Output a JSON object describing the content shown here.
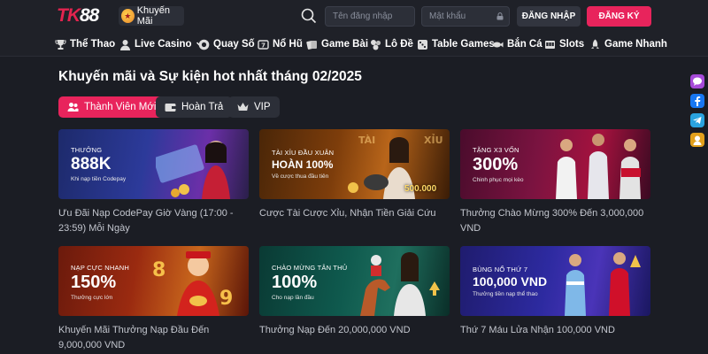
{
  "header": {
    "logo_tk": "TK",
    "logo_88": "88",
    "promo_label": "Khuyến Mãi",
    "username_placeholder": "Tên đăng nhập",
    "password_placeholder": "Mật khẩu",
    "login_label": "ĐĂNG NHẬP",
    "register_label": "ĐĂNG KÝ"
  },
  "nav": {
    "items": [
      {
        "label": "Thể Thao",
        "icon": "trophy-icon"
      },
      {
        "label": "Live Casino",
        "icon": "user-icon"
      },
      {
        "label": "Quay Số",
        "icon": "lottery-ball-icon"
      },
      {
        "label": "Nổ Hũ",
        "icon": "slot-icon"
      },
      {
        "label": "Game Bài",
        "icon": "cards-icon"
      },
      {
        "label": "Lô Đề",
        "icon": "balls-icon"
      },
      {
        "label": "Table Games",
        "icon": "dice-icon"
      },
      {
        "label": "Bắn Cá",
        "icon": "fish-icon"
      },
      {
        "label": "Slots",
        "icon": "machine-icon"
      },
      {
        "label": "Game Nhanh",
        "icon": "rocket-icon"
      }
    ]
  },
  "page": {
    "title": "Khuyến mãi và Sự kiện hot nhất tháng 02/2025"
  },
  "tabs": [
    {
      "label": "Thành Viên Mới",
      "icon": "users-icon",
      "active": true
    },
    {
      "label": "Hoàn Trả",
      "icon": "wallet-icon",
      "active": false
    },
    {
      "label": "VIP",
      "icon": "crown-icon",
      "active": false
    }
  ],
  "promotions": [
    {
      "banner_top": "THƯỞNG",
      "banner_big": "888K",
      "banner_sub": "Khi nạp tiền Codepay",
      "title": "Ưu Đãi Nạp CodePay Giờ Vàng (17:00 - 23:59) Mỗi Ngày"
    },
    {
      "banner_top": "TÀI XỈU ĐẦU XUÂN",
      "banner_big": "HOÀN 100%",
      "banner_sub": "Về cược thua đầu tiên",
      "banner_amount": "500.000",
      "title": "Cược Tài Cược Xỉu, Nhận Tiền Giải Cứu"
    },
    {
      "banner_top": "TẶNG X3 VỐN",
      "banner_big": "300%",
      "banner_sub": "Chinh phục mọi kèo",
      "title": "Thưởng Chào Mừng 300% Đến 3,000,000 VND"
    },
    {
      "banner_top": "NẠP CỰC NHANH",
      "banner_big": "150%",
      "banner_sub": "Thưởng cực lớn",
      "title": "Khuyến Mãi Thưởng Nạp Đầu Đến 9,000,000 VND"
    },
    {
      "banner_top": "CHÀO MỪNG TÂN THỦ",
      "banner_big": "100%",
      "banner_sub": "Cho nạp lần đầu",
      "title": "Thưởng Nạp Đến 20,000,000 VND"
    },
    {
      "banner_top": "BÙNG NỔ THỨ 7",
      "banner_big": "100,000 VND",
      "banner_sub": "Thưởng tiền nạp thể thao",
      "title": "Thứ 7 Máu Lửa Nhận 100,000 VND"
    }
  ],
  "social": [
    {
      "icon": "chat-icon",
      "color": "#a64ad8"
    },
    {
      "icon": "facebook-icon",
      "color": "#1877f2"
    },
    {
      "icon": "telegram-icon",
      "color": "#2aa3df"
    },
    {
      "icon": "support-icon",
      "color": "#e2a01c"
    }
  ],
  "colors": {
    "accent": "#e8245c",
    "background": "#1b1d24"
  }
}
